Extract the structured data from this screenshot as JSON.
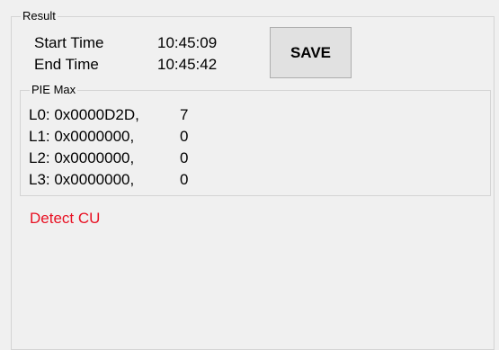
{
  "result": {
    "group_title": "Result",
    "start_time_label": "Start Time",
    "start_time_value": "10:45:09",
    "end_time_label": "End Time",
    "end_time_value": "10:45:42",
    "save_label": "SAVE"
  },
  "pie_max": {
    "group_title": "PIE Max",
    "rows": [
      {
        "addr": "L0: 0x0000D2D,",
        "count": "7"
      },
      {
        "addr": "L1: 0x0000000,",
        "count": "0"
      },
      {
        "addr": "L2: 0x0000000,",
        "count": "0"
      },
      {
        "addr": "L3: 0x0000000,",
        "count": "0"
      }
    ]
  },
  "status": {
    "text": "Detect CU",
    "color": "#e81123"
  }
}
